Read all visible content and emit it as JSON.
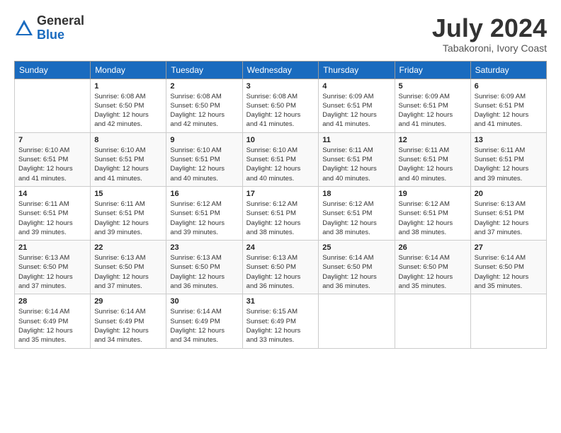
{
  "logo": {
    "general": "General",
    "blue": "Blue"
  },
  "title": {
    "month_year": "July 2024",
    "location": "Tabakoroni, Ivory Coast"
  },
  "days_of_week": [
    "Sunday",
    "Monday",
    "Tuesday",
    "Wednesday",
    "Thursday",
    "Friday",
    "Saturday"
  ],
  "weeks": [
    [
      {
        "day": "",
        "info": ""
      },
      {
        "day": "1",
        "info": "Sunrise: 6:08 AM\nSunset: 6:50 PM\nDaylight: 12 hours\nand 42 minutes."
      },
      {
        "day": "2",
        "info": "Sunrise: 6:08 AM\nSunset: 6:50 PM\nDaylight: 12 hours\nand 42 minutes."
      },
      {
        "day": "3",
        "info": "Sunrise: 6:08 AM\nSunset: 6:50 PM\nDaylight: 12 hours\nand 41 minutes."
      },
      {
        "day": "4",
        "info": "Sunrise: 6:09 AM\nSunset: 6:51 PM\nDaylight: 12 hours\nand 41 minutes."
      },
      {
        "day": "5",
        "info": "Sunrise: 6:09 AM\nSunset: 6:51 PM\nDaylight: 12 hours\nand 41 minutes."
      },
      {
        "day": "6",
        "info": "Sunrise: 6:09 AM\nSunset: 6:51 PM\nDaylight: 12 hours\nand 41 minutes."
      }
    ],
    [
      {
        "day": "7",
        "info": "Sunrise: 6:10 AM\nSunset: 6:51 PM\nDaylight: 12 hours\nand 41 minutes."
      },
      {
        "day": "8",
        "info": "Sunrise: 6:10 AM\nSunset: 6:51 PM\nDaylight: 12 hours\nand 41 minutes."
      },
      {
        "day": "9",
        "info": "Sunrise: 6:10 AM\nSunset: 6:51 PM\nDaylight: 12 hours\nand 40 minutes."
      },
      {
        "day": "10",
        "info": "Sunrise: 6:10 AM\nSunset: 6:51 PM\nDaylight: 12 hours\nand 40 minutes."
      },
      {
        "day": "11",
        "info": "Sunrise: 6:11 AM\nSunset: 6:51 PM\nDaylight: 12 hours\nand 40 minutes."
      },
      {
        "day": "12",
        "info": "Sunrise: 6:11 AM\nSunset: 6:51 PM\nDaylight: 12 hours\nand 40 minutes."
      },
      {
        "day": "13",
        "info": "Sunrise: 6:11 AM\nSunset: 6:51 PM\nDaylight: 12 hours\nand 39 minutes."
      }
    ],
    [
      {
        "day": "14",
        "info": "Sunrise: 6:11 AM\nSunset: 6:51 PM\nDaylight: 12 hours\nand 39 minutes."
      },
      {
        "day": "15",
        "info": "Sunrise: 6:11 AM\nSunset: 6:51 PM\nDaylight: 12 hours\nand 39 minutes."
      },
      {
        "day": "16",
        "info": "Sunrise: 6:12 AM\nSunset: 6:51 PM\nDaylight: 12 hours\nand 39 minutes."
      },
      {
        "day": "17",
        "info": "Sunrise: 6:12 AM\nSunset: 6:51 PM\nDaylight: 12 hours\nand 38 minutes."
      },
      {
        "day": "18",
        "info": "Sunrise: 6:12 AM\nSunset: 6:51 PM\nDaylight: 12 hours\nand 38 minutes."
      },
      {
        "day": "19",
        "info": "Sunrise: 6:12 AM\nSunset: 6:51 PM\nDaylight: 12 hours\nand 38 minutes."
      },
      {
        "day": "20",
        "info": "Sunrise: 6:13 AM\nSunset: 6:51 PM\nDaylight: 12 hours\nand 37 minutes."
      }
    ],
    [
      {
        "day": "21",
        "info": "Sunrise: 6:13 AM\nSunset: 6:50 PM\nDaylight: 12 hours\nand 37 minutes."
      },
      {
        "day": "22",
        "info": "Sunrise: 6:13 AM\nSunset: 6:50 PM\nDaylight: 12 hours\nand 37 minutes."
      },
      {
        "day": "23",
        "info": "Sunrise: 6:13 AM\nSunset: 6:50 PM\nDaylight: 12 hours\nand 36 minutes."
      },
      {
        "day": "24",
        "info": "Sunrise: 6:13 AM\nSunset: 6:50 PM\nDaylight: 12 hours\nand 36 minutes."
      },
      {
        "day": "25",
        "info": "Sunrise: 6:14 AM\nSunset: 6:50 PM\nDaylight: 12 hours\nand 36 minutes."
      },
      {
        "day": "26",
        "info": "Sunrise: 6:14 AM\nSunset: 6:50 PM\nDaylight: 12 hours\nand 35 minutes."
      },
      {
        "day": "27",
        "info": "Sunrise: 6:14 AM\nSunset: 6:50 PM\nDaylight: 12 hours\nand 35 minutes."
      }
    ],
    [
      {
        "day": "28",
        "info": "Sunrise: 6:14 AM\nSunset: 6:49 PM\nDaylight: 12 hours\nand 35 minutes."
      },
      {
        "day": "29",
        "info": "Sunrise: 6:14 AM\nSunset: 6:49 PM\nDaylight: 12 hours\nand 34 minutes."
      },
      {
        "day": "30",
        "info": "Sunrise: 6:14 AM\nSunset: 6:49 PM\nDaylight: 12 hours\nand 34 minutes."
      },
      {
        "day": "31",
        "info": "Sunrise: 6:15 AM\nSunset: 6:49 PM\nDaylight: 12 hours\nand 33 minutes."
      },
      {
        "day": "",
        "info": ""
      },
      {
        "day": "",
        "info": ""
      },
      {
        "day": "",
        "info": ""
      }
    ]
  ]
}
